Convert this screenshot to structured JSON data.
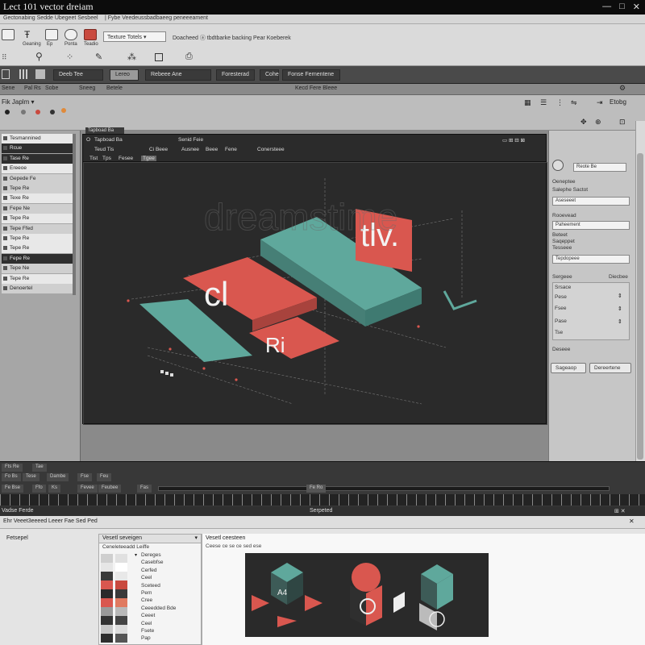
{
  "window": {
    "title": "Lect 101   vector dreiam",
    "controls": [
      "—",
      "□",
      "✕"
    ]
  },
  "menubar": {
    "left_text": "Gectonabing Sedde Ubegeet Sesbeel",
    "right_text": "| Fybe Veedeussbadbaeeg peneeeament"
  },
  "ribbon": {
    "labels": [
      "Geaning",
      "Ep",
      "Ponta",
      "Teadio"
    ],
    "dropdown": "Texture Totels ▾",
    "info_text": "Doacheed ⓐ tbdtbarke backing Pear Koeberek"
  },
  "darkbar": {
    "chips": [
      "Deeb  Tee",
      "Lereo",
      "Rebeee Ane",
      "Foresterad",
      "Cohe",
      "Fonse Fernentene"
    ]
  },
  "subbar": {
    "items": [
      "Sene",
      "Pal Rs",
      "Sobe",
      "Sneeg",
      "Betele",
      "Kecd Fere Bleee"
    ]
  },
  "toolrow": {
    "left_label": "Fik  Japlm ▾",
    "right_label": "Etobg"
  },
  "left_panel": {
    "rows": [
      {
        "label": "Tesmannined",
        "style": "hi"
      },
      {
        "label": "Rcue",
        "style": "dark"
      },
      {
        "label": "Tase Re",
        "style": "dark"
      },
      {
        "label": "Ereeoe",
        "style": "hi"
      },
      {
        "label": "Gepede Fe",
        "style": "band"
      },
      {
        "label": "Tepe Re",
        "style": "band"
      },
      {
        "label": "Texe Re",
        "style": "hi"
      },
      {
        "label": "Fepe Ne",
        "style": "band"
      },
      {
        "label": "Tepe Re",
        "style": "hi"
      },
      {
        "label": "Tepe Ffed",
        "style": "band"
      },
      {
        "label": "Tepe Re",
        "style": "hi"
      },
      {
        "label": "Tepe Re",
        "style": "hi"
      },
      {
        "label": "Fepe Re",
        "style": "dark"
      },
      {
        "label": "Tepe Ne",
        "style": "band"
      },
      {
        "label": "Tepe Re",
        "style": "hi"
      },
      {
        "label": "Denoertel",
        "style": "band"
      }
    ]
  },
  "viewport": {
    "tab_row1": [
      "Tapboad Ba",
      "Senid Feie"
    ],
    "tab_row2": [
      "Teud Tis",
      "Ci Beee",
      "Ausnee",
      "Beee",
      "Fene",
      "Conersteee"
    ],
    "tab_row3": [
      "Tist",
      "Tps",
      "Fesee",
      "Tgee"
    ],
    "art": {
      "text_big": "cl",
      "text_mid": "tlv.",
      "text_small": "Ri",
      "teal": "#5fa89c",
      "coral": "#d9574f",
      "bg": "#2a2a2a",
      "watermark": "dreamstime"
    }
  },
  "right_panel": {
    "top_field": "Reote Be",
    "labels": [
      "Oeneptee",
      "Salephe Sactot",
      "Rooevead"
    ],
    "fields": [
      "Aseseeet",
      "Paheement",
      "Tepdopeee"
    ],
    "labels2": [
      "Beteet",
      "Saqeppet",
      "Tesseee"
    ],
    "section": "Sergeee",
    "section_right": "Diecbee",
    "props": [
      "Srsace",
      "Pese",
      "Fsee",
      "Pase",
      "Tse"
    ],
    "footer": "Deseee",
    "buttons": [
      "Sageaop",
      "Dereertene"
    ]
  },
  "timeline": {
    "row1": [
      "Fts Re",
      "Tae"
    ],
    "row2": [
      "Fo Bs",
      "Tese",
      "Dambe",
      "Fse",
      "Feu"
    ],
    "row3": [
      "Fe Bse",
      "Ffo",
      "Ks",
      "Fevee",
      "Feubee",
      "Fas"
    ],
    "ruler_label": "Fe Ro"
  },
  "bottom_header": {
    "left": "Vadse Ferde",
    "center": "Serpeted"
  },
  "bottom": {
    "bar_text": "Ehr Veeet3eeeed Leeer Fae Sed Ped",
    "left_label": "Fetsepel",
    "mid_header": "Vesetl seveigen",
    "mid_sub": "Ceneleteeadd Leiffe",
    "mid_items": [
      "Dereges",
      "Casebfse",
      "Cerfed",
      "Ceel",
      "Sceteed",
      "Pem",
      "Cree",
      "Ceeedded Bde",
      "Ceeet",
      "Ceel",
      "Fsete",
      "Pap"
    ],
    "right_header": "Vesetl ceesteen",
    "right_sub": "Ceese ce se ce sed ese",
    "preview_label": "A4"
  }
}
